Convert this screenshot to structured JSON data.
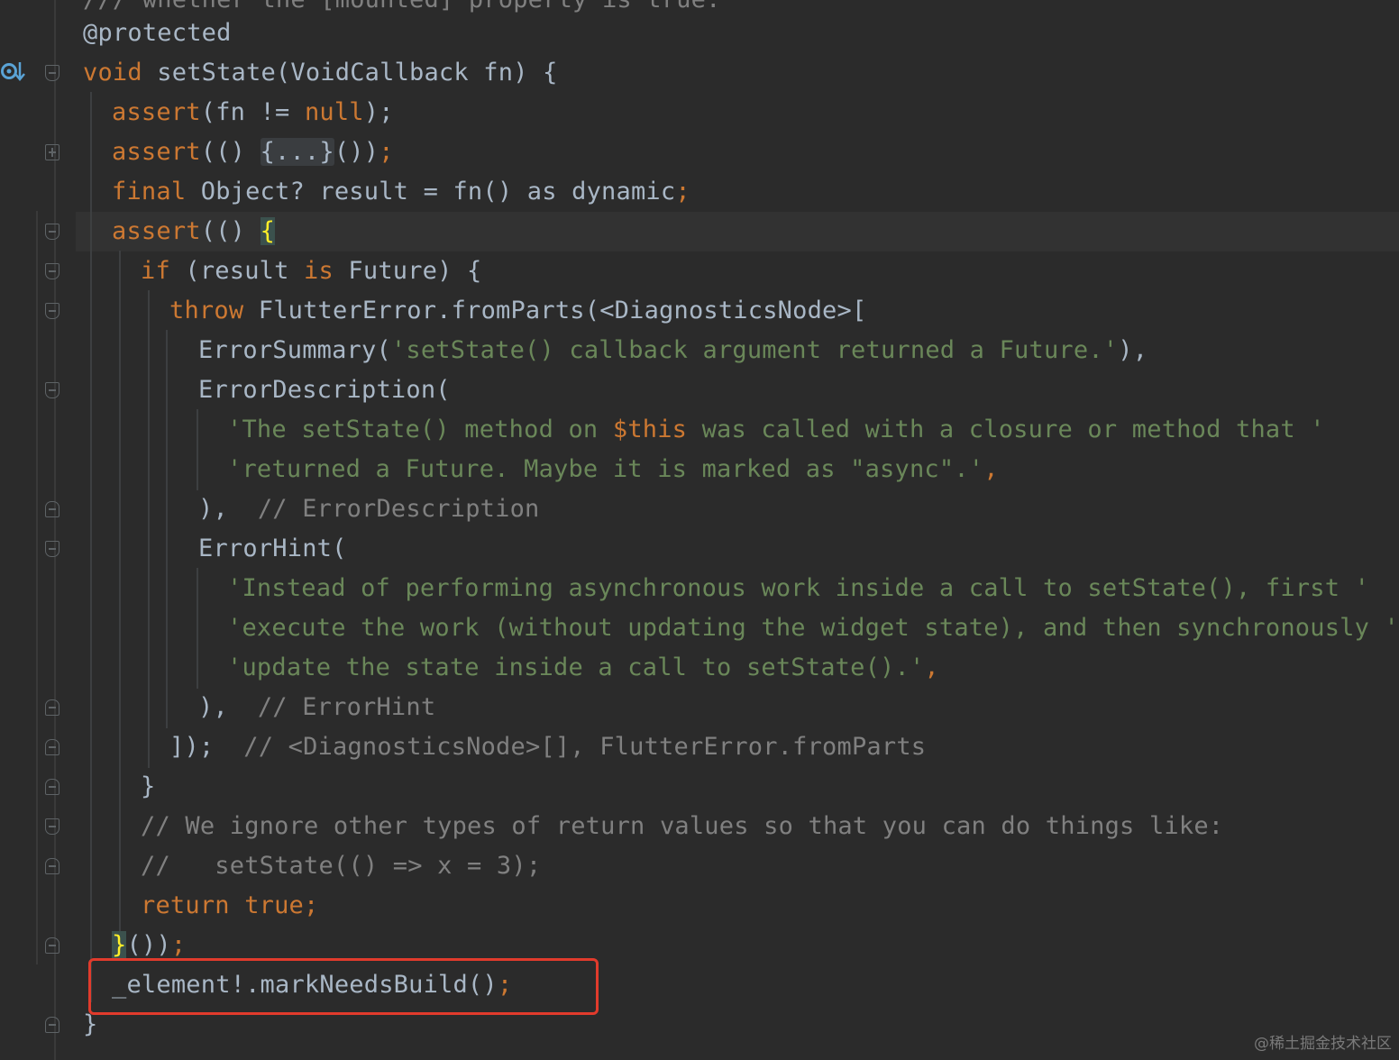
{
  "editor": {
    "language": "Dart",
    "lines": {
      "l0": "/// whether the [mounted] property is true.",
      "l1": "@protected",
      "l2_kw": "void",
      "l2_rest": " setState(VoidCallback fn) {",
      "l3_assert": "assert",
      "l3_mid": "(fn != ",
      "l3_null": "null",
      "l3_end": ");",
      "l4_assert": "assert",
      "l4_mid": "(() ",
      "l4_fold": "{...}",
      "l4_end": "())",
      "l4_semi": ";",
      "l5_final": "final",
      "l5_mid": " Object? result = fn() as dynamic",
      "l5_semi": ";",
      "l6_assert": "assert",
      "l6_mid": "(() ",
      "l6_brace": "{",
      "l7_if": "if",
      "l7_mid": " (result ",
      "l7_is": "is",
      "l7_end": " Future) {",
      "l8_throw": "throw",
      "l8_rest": " FlutterError.fromParts(<DiagnosticsNode>[",
      "l9_fn": "ErrorSummary(",
      "l9_str": "'setState() callback argument returned a Future.'",
      "l9_end": "),",
      "l10": "ErrorDescription(",
      "l11_str1": "'The setState() method on ",
      "l11_dollar": "$",
      "l11_this": "this",
      "l11_str2": " was called with a closure or method that '",
      "l12_str": "'returned a Future. Maybe it is marked as \"async\".'",
      "l12_end": ",",
      "l13_close": "),",
      "l13_cmt": "  // ErrorDescription",
      "l14": "ErrorHint(",
      "l15_str": "'Instead of performing asynchronous work inside a call to setState(), first '",
      "l16_str": "'execute the work (without updating the widget state), and then synchronously '",
      "l17_str": "'update the state inside a call to setState().'",
      "l17_end": ",",
      "l18_close": "),",
      "l18_cmt": "  // ErrorHint",
      "l19_close": "]);",
      "l19_cmt": "  // <DiagnosticsNode>[], FlutterError.fromParts",
      "l20": "}",
      "l21_cmt": "// We ignore other types of return values so that you can do things like:",
      "l22_cmt": "//   setState(() => x = 3);",
      "l23_return": "return",
      "l23_true": " true",
      "l23_semi": ";",
      "l24_brace": "}",
      "l24_end": "())",
      "l24_semi": ";",
      "l25_code": "_element!.markNeedsBuild()",
      "l25_semi": ";",
      "l26": "}"
    },
    "override_icon": "override-method-icon"
  },
  "watermark": "@稀土掘金技术社区",
  "colors": {
    "background": "#2b2b2b",
    "keyword": "#cc7832",
    "string": "#6a8759",
    "comment": "#808080",
    "annotation": "#bbb529",
    "text": "#a9b7c6",
    "highlight_box": "#e13b2c"
  }
}
